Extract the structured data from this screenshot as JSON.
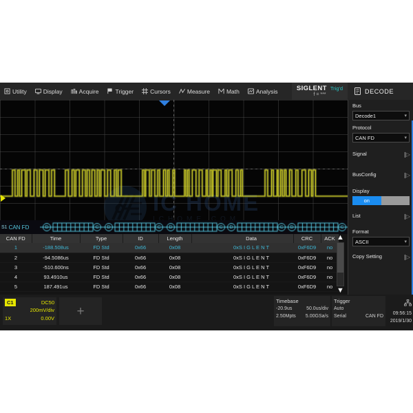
{
  "menu": {
    "items": [
      {
        "label": "Utility",
        "icon": "utility-icon"
      },
      {
        "label": "Display",
        "icon": "display-icon"
      },
      {
        "label": "Acquire",
        "icon": "acquire-icon"
      },
      {
        "label": "Trigger",
        "icon": "trigger-flag-icon"
      },
      {
        "label": "Cursors",
        "icon": "cursors-icon"
      },
      {
        "label": "Measure",
        "icon": "measure-icon"
      },
      {
        "label": "Math",
        "icon": "math-icon"
      },
      {
        "label": "Analysis",
        "icon": "analysis-icon"
      }
    ]
  },
  "brand": {
    "name": "SIGLENT",
    "trigger_status": "Trig'd",
    "frequency": "f = ***"
  },
  "decode_button": {
    "label": "DECODE",
    "icon": "decode-icon"
  },
  "watermark": {
    "main": "IC HOME",
    "sub": "ICHOME.COM"
  },
  "bus_strip": {
    "source": "S1",
    "protocol": "CAN FD",
    "packets": [
      {
        "start": "D",
        "end": "C"
      },
      {
        "start": "D",
        "end": "C"
      },
      {
        "start": "D",
        "end": "C"
      },
      {
        "start": "D",
        "end": "C"
      },
      {
        "start": "D",
        "end": "C"
      }
    ]
  },
  "table": {
    "headers": [
      "CAN FD",
      "Time",
      "Type",
      "ID",
      "Length",
      "Data",
      "CRC",
      "ACK"
    ],
    "rows": [
      {
        "index": "1",
        "time": "-188.508us",
        "type": "FD Std",
        "id": "0x66",
        "length": "0x08",
        "data": "0xS I G L E N T",
        "crc": "0xF6D9",
        "ack": "no",
        "selected": true
      },
      {
        "index": "2",
        "time": "-94.5086us",
        "type": "FD Std",
        "id": "0x66",
        "length": "0x08",
        "data": "0xS I G L E N T",
        "crc": "0xF6D9",
        "ack": "no",
        "selected": false
      },
      {
        "index": "3",
        "time": "-510.600ns",
        "type": "FD Std",
        "id": "0x66",
        "length": "0x08",
        "data": "0xS I G L E N T",
        "crc": "0xF6D9",
        "ack": "no",
        "selected": false
      },
      {
        "index": "4",
        "time": "93.4910us",
        "type": "FD Std",
        "id": "0x66",
        "length": "0x08",
        "data": "0xS I G L E N T",
        "crc": "0xF6D9",
        "ack": "no",
        "selected": false
      },
      {
        "index": "5",
        "time": "187.491us",
        "type": "FD Std",
        "id": "0x66",
        "length": "0x08",
        "data": "0xS I G L E N T",
        "crc": "0xF6D9",
        "ack": "no",
        "selected": false
      }
    ],
    "scroll_up_icon": "chevron-up-icon",
    "scroll_down_icon": "chevron-down-icon"
  },
  "status": {
    "channel": {
      "name": "C1",
      "coupling": "DC50",
      "scale": "200mV/div",
      "probe": "1X",
      "offset": "0.00V"
    },
    "add_channel_icon": "plus-icon",
    "timebase": {
      "title": "Timebase",
      "delay": "-20.9us",
      "scale": "50.0us/div",
      "memory": "2.50Mpts",
      "samplerate": "5.00GSa/s"
    },
    "trigger": {
      "title": "Trigger",
      "mode": "Auto",
      "type": "Serial",
      "source": "CAN FD"
    },
    "clock": {
      "icon": "network-icon",
      "time": "09:56:15",
      "date": "2019/1/30"
    }
  },
  "sidepanel": {
    "bus": {
      "label": "Bus",
      "value": "Decode1"
    },
    "protocol": {
      "label": "Protocol",
      "value": "CAN FD"
    },
    "signal": {
      "label": "Signal"
    },
    "busconfig": {
      "label": "BusConfig"
    },
    "display": {
      "label": "Display",
      "value": "on"
    },
    "list": {
      "label": "List"
    },
    "format": {
      "label": "Format",
      "value": "ASCII"
    },
    "copy_setting": {
      "label": "Copy Setting"
    }
  },
  "colors": {
    "channel": "#e6e600",
    "accent": "#2f7fe0",
    "decode": "#56c8e0",
    "selected_text": "#3fb8d6",
    "trigd": "#29c7c7"
  }
}
